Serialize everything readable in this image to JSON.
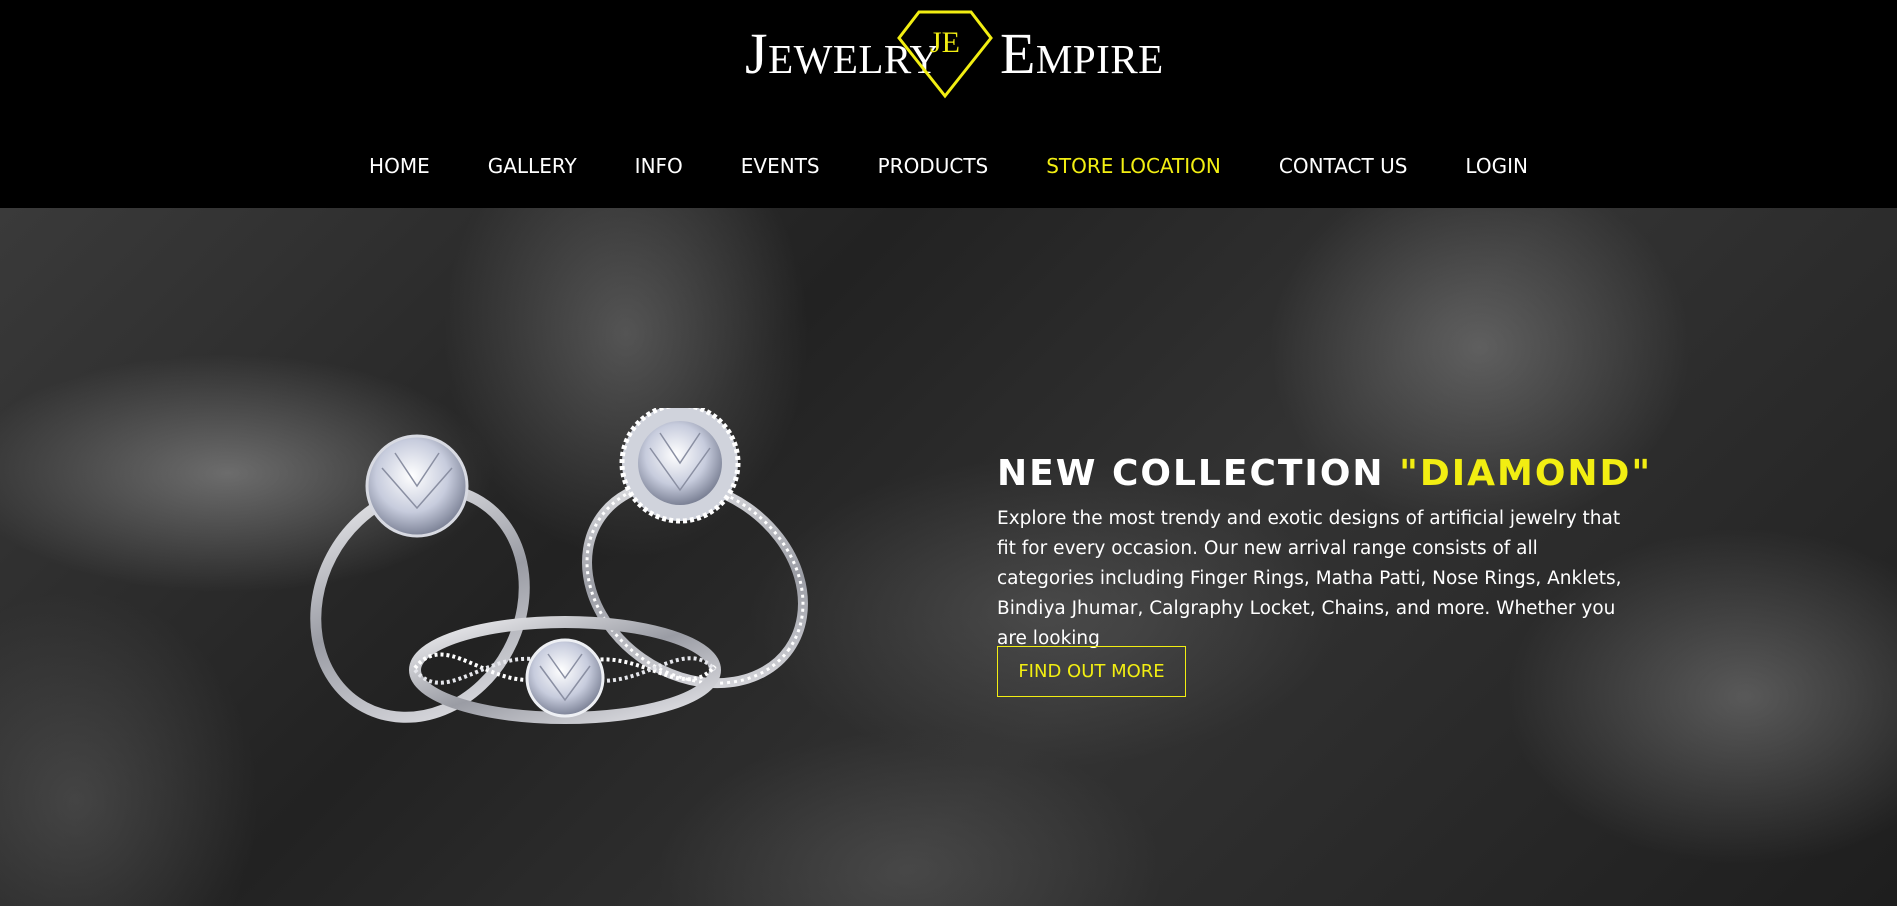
{
  "brand": {
    "word_left": "Jewelry",
    "monogram": "JE",
    "word_right": "Empire"
  },
  "nav": {
    "items": [
      {
        "label": "HOME"
      },
      {
        "label": "GALLERY"
      },
      {
        "label": "INFO"
      },
      {
        "label": "EVENTS"
      },
      {
        "label": "PRODUCTS"
      },
      {
        "label": "STORE LOCATION",
        "active": true
      },
      {
        "label": "CONTACT US"
      },
      {
        "label": "LOGIN"
      }
    ]
  },
  "hero": {
    "headline_prefix": "NEW COLLECTION ",
    "headline_accent": "\"DIAMOND\"",
    "description": "Explore the most trendy and exotic designs of artificial jewelry that fit for every occasion. Our new arrival range consists of all categories including Finger Rings, Matha Patti, Nose Rings, Anklets, Bindiya Jhumar, Calgraphy Locket, Chains, and more. Whether you are looking",
    "cta_label": "FIND OUT MORE",
    "image_icon": "diamond-rings-image"
  },
  "colors": {
    "accent": "#f2ee12",
    "header_bg": "#000000",
    "text": "#ffffff"
  }
}
